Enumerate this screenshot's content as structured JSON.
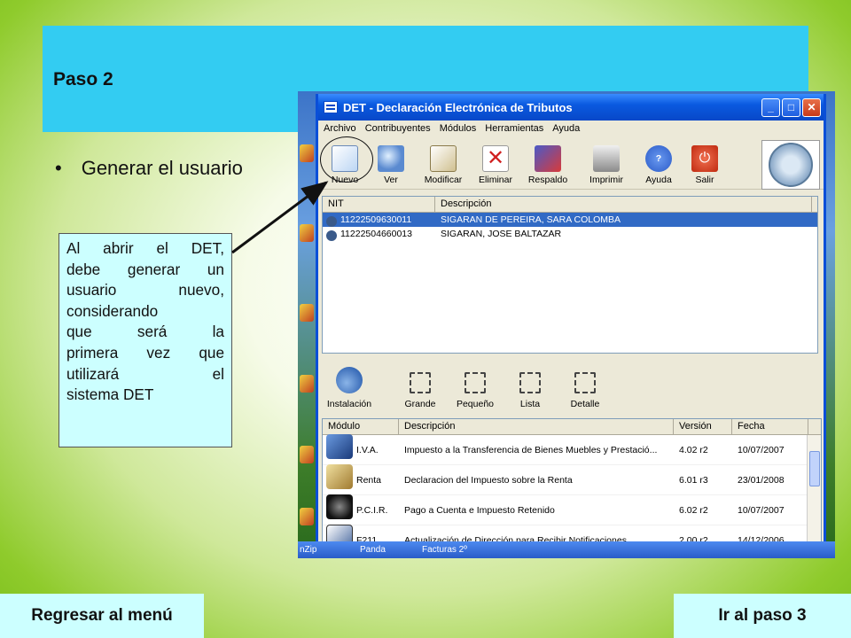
{
  "slide": {
    "title": "Paso 2",
    "bullet": "Generar el usuario",
    "callout_lines": [
      "Al abrir el DET,",
      "debe generar un",
      "usuario nuevo,",
      "considerando",
      "que será la",
      "primera vez que",
      "utilizará el",
      "sistema DET"
    ],
    "nav_back": "Regresar al menú",
    "nav_next": "Ir al paso 3",
    "colors": {
      "header": "#33ccf2",
      "callout": "#ccffff",
      "background": "#8fcb2c"
    }
  },
  "app": {
    "title": "DET - Declaración Electrónica de Tributos",
    "menu": [
      "Archivo",
      "Contribuyentes",
      "Módulos",
      "Herramientas",
      "Ayuda"
    ],
    "toolbar": [
      "Nuevo",
      "Ver",
      "Modificar",
      "Eliminar",
      "Respaldo",
      "Imprimir",
      "Ayuda",
      "Salir"
    ],
    "contribuyentes": {
      "headers": [
        "NIT",
        "Descripción"
      ],
      "rows": [
        {
          "nit": "11222509630011",
          "desc": "SIGARAN DE PEREIRA, SARA COLOMBA"
        },
        {
          "nit": "11222504660013",
          "desc": "SIGARAN, JOSE BALTAZAR"
        }
      ]
    },
    "view_toolbar": [
      "Instalación",
      "Grande",
      "Pequeño",
      "Lista",
      "Detalle"
    ],
    "modulos": {
      "headers": [
        "Módulo",
        "Descripción",
        "Versión",
        "Fecha"
      ],
      "rows": [
        {
          "modulo": "I.V.A.",
          "desc": "Impuesto a la Transferencia de Bienes Muebles y Prestació...",
          "version": "4.02 r2",
          "fecha": "10/07/2007"
        },
        {
          "modulo": "Renta",
          "desc": "Declaracion del Impuesto sobre la Renta",
          "version": "6.01 r3",
          "fecha": "23/01/2008"
        },
        {
          "modulo": "P.C.I.R.",
          "desc": "Pago a Cuenta e Impuesto Retenido",
          "version": "6.02 r2",
          "fecha": "10/07/2007"
        },
        {
          "modulo": "F211",
          "desc": "Actualización de Dirección para Recibir Notificaciones",
          "version": "2.00 r2",
          "fecha": "14/12/2006"
        }
      ]
    }
  },
  "taskbar": [
    "nZip",
    "Panda",
    "Facturas 2º"
  ]
}
